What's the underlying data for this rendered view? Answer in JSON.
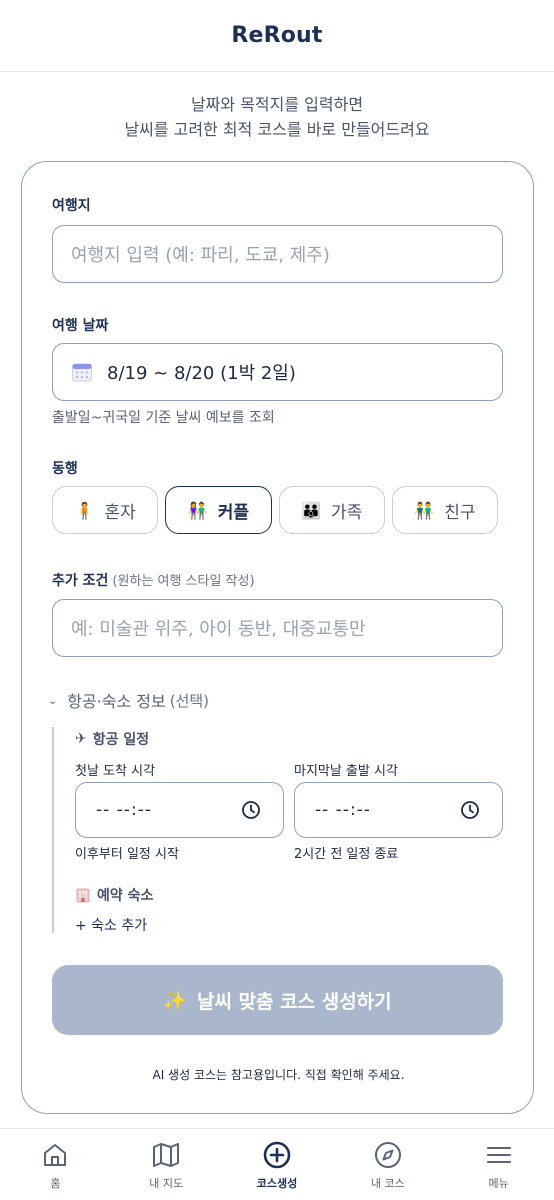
{
  "header": {
    "title": "ReRout"
  },
  "intro": {
    "line1": "날짜와 목적지를 입력하면",
    "line2": "날씨를 고려한 최적 코스를 바로 만들어드려요"
  },
  "destination": {
    "label": "여행지",
    "placeholder": "여행지 입력 (예: 파리, 도쿄, 제주)"
  },
  "dates": {
    "label": "여행 날짜",
    "value": "8/19 ~ 8/20 (1박 2일)",
    "note": "출발일~귀국일 기준 날씨 예보를 조회",
    "icon": "calendar-icon"
  },
  "companion": {
    "label": "동행",
    "options": [
      {
        "emoji": "🧍",
        "label": "혼자",
        "selected": false
      },
      {
        "emoji": "👫",
        "label": "커플",
        "selected": true
      },
      {
        "emoji": "👪",
        "label": "가족",
        "selected": false
      },
      {
        "emoji": "👬",
        "label": "친구",
        "selected": false
      }
    ]
  },
  "extra": {
    "label": "추가 조건",
    "hint": "(원하는 여행 스타일 작성)",
    "placeholder": "예: 미술관 위주, 아이 동반, 대중교통만"
  },
  "travel_info": {
    "label": "항공·숙소 정보",
    "optional": "(선택)",
    "expanded": true,
    "flight": {
      "title": "항공 일정",
      "icon": "airplane-icon",
      "arrival_label": "첫날 도착 시각",
      "arrival_value": "-- --:--",
      "arrival_note": "이후부터 일정 시작",
      "departure_label": "마지막날 출발 시각",
      "departure_value": "-- --:--",
      "departure_note": "2시간 전 일정 종료"
    },
    "lodging": {
      "title": "예약 숙소",
      "icon": "hotel-icon",
      "add_label": "+ 숙소 추가"
    }
  },
  "generate": {
    "icon": "✨",
    "label": "날씨 맞춤 코스 생성하기",
    "enabled": false
  },
  "disclaimer": "AI 생성 코스는 참고용입니다. 직접 확인해 주세요.",
  "tabbar": {
    "tabs": [
      {
        "label": "홈",
        "icon": "home-icon",
        "active": false
      },
      {
        "label": "내 지도",
        "icon": "map-icon",
        "active": false
      },
      {
        "label": "코스생성",
        "icon": "plus-circle-icon",
        "active": true
      },
      {
        "label": "내 코스",
        "icon": "compass-icon",
        "active": false
      },
      {
        "label": "메뉴",
        "icon": "menu-icon",
        "active": false
      }
    ]
  },
  "colors": {
    "primary": "#1e2f55",
    "border": "#8fa0bd",
    "disabled_button": "#a9b6cb",
    "muted_text": "#5b6376"
  }
}
